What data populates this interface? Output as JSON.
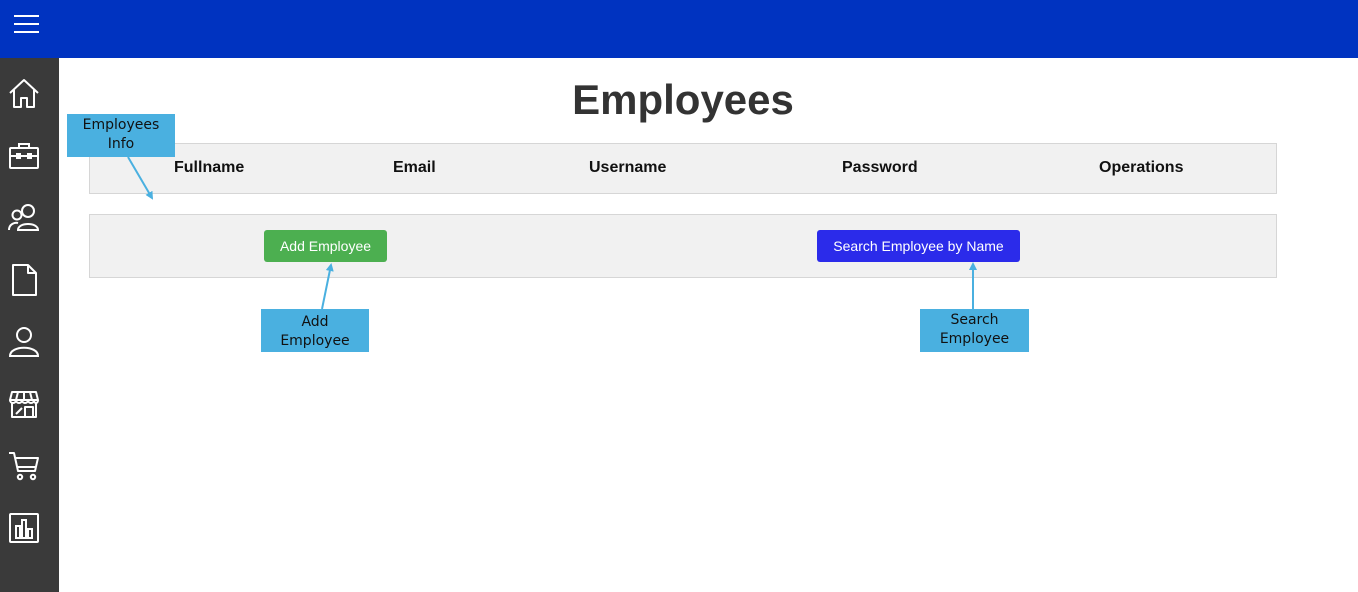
{
  "header": {
    "menu_icon": "hamburger-menu-icon",
    "bg_color": "#0033c0"
  },
  "sidebar": {
    "items": [
      {
        "name": "home",
        "icon": "home-icon"
      },
      {
        "name": "briefcase",
        "icon": "briefcase-icon"
      },
      {
        "name": "employees",
        "icon": "users-icon"
      },
      {
        "name": "documents",
        "icon": "document-icon"
      },
      {
        "name": "profile",
        "icon": "user-icon"
      },
      {
        "name": "store",
        "icon": "store-icon"
      },
      {
        "name": "cart",
        "icon": "cart-icon"
      },
      {
        "name": "reports",
        "icon": "bar-chart-icon"
      }
    ]
  },
  "main": {
    "title": "Employees",
    "columns": [
      "Fullname",
      "Email",
      "Username",
      "Password",
      "Operations"
    ],
    "actions": {
      "add_label": "Add Employee",
      "search_label": "Search Employee by Name"
    }
  },
  "annotations": {
    "employees_info": [
      "Employees",
      "Info"
    ],
    "add_employee": [
      "Add",
      "Employee"
    ],
    "search_employee": [
      "Search",
      "Employee"
    ]
  },
  "colors": {
    "add_button": "#4caf50",
    "search_button": "#2b2bea",
    "annotation": "#4ab0e0",
    "sidebar": "#3a3a3a"
  }
}
